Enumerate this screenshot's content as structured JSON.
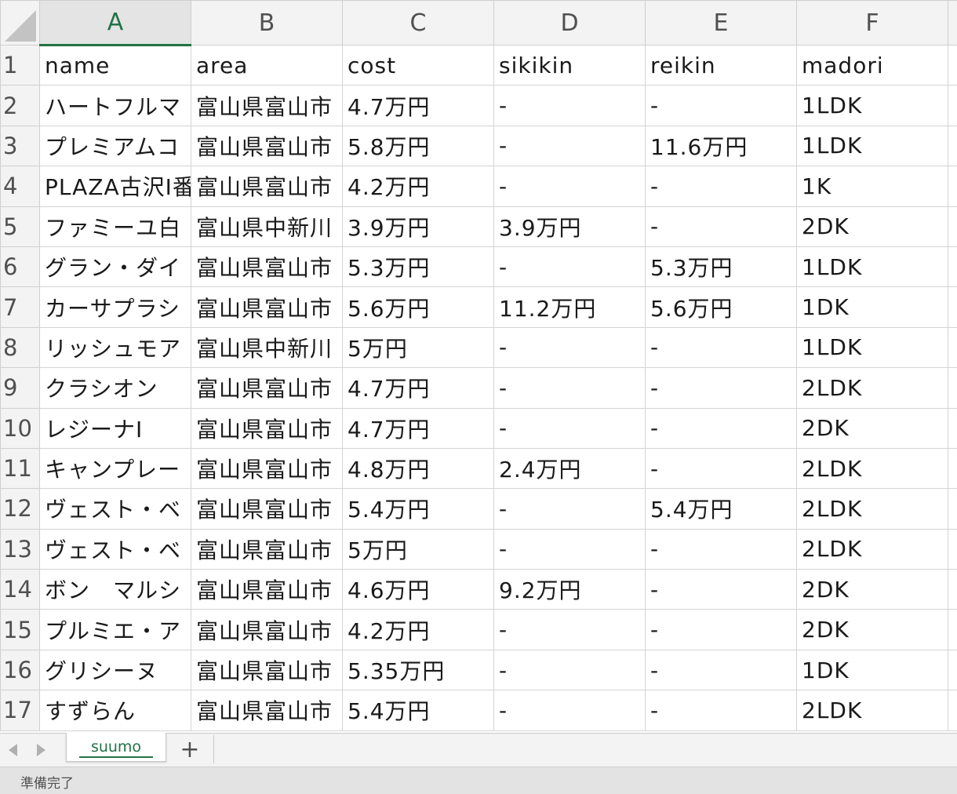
{
  "columns": [
    "A",
    "B",
    "C",
    "D",
    "E",
    "F"
  ],
  "rows": [
    {
      "n": "1",
      "cells": [
        "name",
        "area",
        "cost",
        "sikikin",
        "reikin",
        "madori"
      ]
    },
    {
      "n": "2",
      "cells": [
        "ハートフルマ",
        "富山県富山市",
        "4.7万円",
        "-",
        "-",
        "1LDK"
      ]
    },
    {
      "n": "3",
      "cells": [
        "プレミアムコ",
        "富山県富山市",
        "5.8万円",
        "-",
        "11.6万円",
        "1LDK"
      ]
    },
    {
      "n": "4",
      "cells": [
        "PLAZA古沢I番",
        "富山県富山市",
        "4.2万円",
        "-",
        "-",
        "1K"
      ]
    },
    {
      "n": "5",
      "cells": [
        "ファミーユ白",
        "富山県中新川",
        "3.9万円",
        "3.9万円",
        "-",
        "2DK"
      ]
    },
    {
      "n": "6",
      "cells": [
        "グラン・ダイ",
        "富山県富山市",
        "5.3万円",
        "-",
        "5.3万円",
        "1LDK"
      ]
    },
    {
      "n": "7",
      "cells": [
        "カーサプラシ",
        "富山県富山市",
        "5.6万円",
        "11.2万円",
        "5.6万円",
        "1DK"
      ]
    },
    {
      "n": "8",
      "cells": [
        "リッシュモア",
        "富山県中新川",
        "5万円",
        "-",
        "-",
        "1LDK"
      ]
    },
    {
      "n": "9",
      "cells": [
        "クラシオン",
        "富山県富山市",
        "4.7万円",
        "-",
        "-",
        "2LDK"
      ]
    },
    {
      "n": "10",
      "cells": [
        "レジーナI",
        "富山県富山市",
        "4.7万円",
        "-",
        "-",
        "2DK"
      ]
    },
    {
      "n": "11",
      "cells": [
        "キャンプレー",
        "富山県富山市",
        "4.8万円",
        "2.4万円",
        "-",
        "2LDK"
      ]
    },
    {
      "n": "12",
      "cells": [
        "ヴェスト・ベ",
        "富山県富山市",
        "5.4万円",
        "-",
        "5.4万円",
        "2LDK"
      ]
    },
    {
      "n": "13",
      "cells": [
        "ヴェスト・ベ",
        "富山県富山市",
        "5万円",
        "-",
        "-",
        "2LDK"
      ]
    },
    {
      "n": "14",
      "cells": [
        "ボン　マルシ",
        "富山県富山市",
        "4.6万円",
        "9.2万円",
        "-",
        "2DK"
      ]
    },
    {
      "n": "15",
      "cells": [
        "プルミエ・ア",
        "富山県富山市",
        "4.2万円",
        "-",
        "-",
        "2DK"
      ]
    },
    {
      "n": "16",
      "cells": [
        "グリシーヌ",
        "富山県富山市",
        "5.35万円",
        "-",
        "-",
        "1DK"
      ]
    },
    {
      "n": "17",
      "cells": [
        "すずらん",
        "富山県富山市",
        "5.4万円",
        "-",
        "-",
        "2LDK"
      ]
    }
  ],
  "tabs": {
    "sheet": "suumo",
    "add": "+"
  },
  "status": {
    "text": "準備完了"
  },
  "colors": {
    "accent": "#217346"
  }
}
